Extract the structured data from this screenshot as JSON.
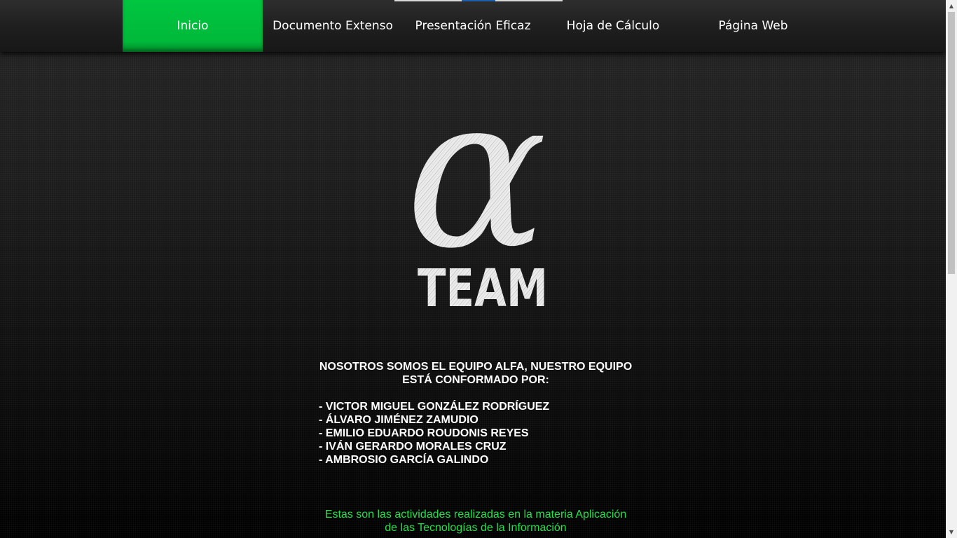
{
  "nav": {
    "items": [
      {
        "label": "Inicio",
        "active": true
      },
      {
        "label": "Documento Extenso",
        "active": false
      },
      {
        "label": "Presentación Eficaz",
        "active": false
      },
      {
        "label": "Hoja de Cálculo",
        "active": false
      },
      {
        "label": "Página Web",
        "active": false
      }
    ],
    "active_color": "#00c640"
  },
  "logo": {
    "symbol": "α",
    "text": "TEAM"
  },
  "main": {
    "intro_line1": "NOSOTROS SOMOS EL EQUIPO ALFA, NUESTRO EQUIPO",
    "intro_line2": "ESTÁ CONFORMADO POR:",
    "members": [
      "- VICTOR MIGUEL GONZÁLEZ RODRÍGUEZ",
      "- ÁLVARO JIMÉNEZ ZAMUDIO",
      "- EMILIO EDUARDO ROUDONIS REYES",
      "- IVÁN GERARDO MORALES CRUZ",
      "- AMBROSIO GARCÍA GALINDO"
    ],
    "footer_line1": "Estas son las actividades realizadas en la materia Aplicación",
    "footer_line2": "de las Tecnologías de la Información",
    "footer_color": "#22e04a"
  },
  "scrollbar": {
    "up_icon": "triangle-up-icon",
    "down_icon": "triangle-down-icon"
  }
}
